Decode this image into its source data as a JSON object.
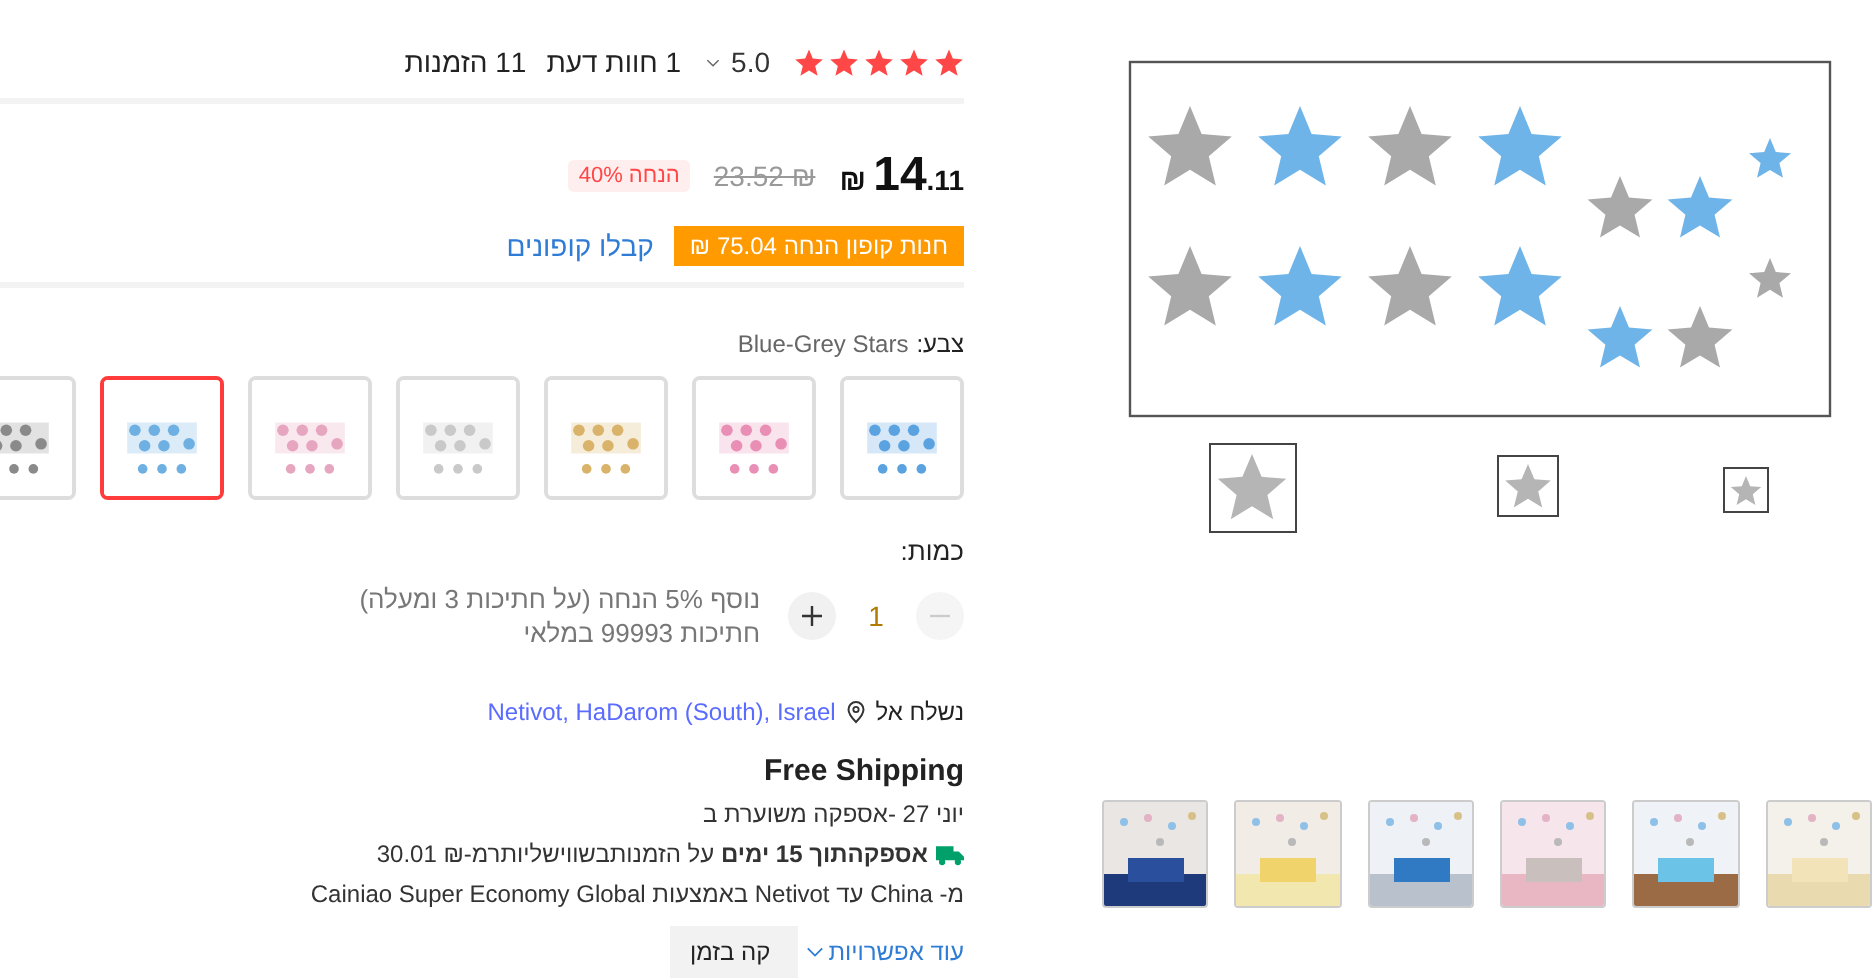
{
  "rating": {
    "stars": 5,
    "score": "5.0",
    "reviews": "1 חוות דעת",
    "orders": "11 הזמנות"
  },
  "price": {
    "currency": "₪",
    "whole": "14",
    "fraction": ".11",
    "original": "23.52 ₪",
    "discount": "הנחה 40%"
  },
  "coupon": {
    "badge": "חנות קופון הנחה 75.04 ₪",
    "link": "קבלו קופונים"
  },
  "color": {
    "label": "צבע:",
    "value": "Blue-Grey Stars"
  },
  "swatches": [
    {
      "kind": "picture",
      "color": "#5aa3e0",
      "selected": false
    },
    {
      "kind": "picture",
      "color": "#e98fb5",
      "selected": false
    },
    {
      "kind": "picture",
      "color": "#d9b36a",
      "selected": false
    },
    {
      "kind": "picture",
      "color": "#c9c9c9",
      "selected": false
    },
    {
      "kind": "picture",
      "color": "#e6a6bf",
      "selected": false
    },
    {
      "kind": "picture",
      "color": "#6fb0e3",
      "selected": true
    },
    {
      "kind": "picture",
      "color": "#8a8a8a",
      "selected": false
    }
  ],
  "quantity": {
    "label": "כמות:",
    "value": "1",
    "minus_disabled": true,
    "note": "נוסף 5% הנחה (על חתיכות 3 ומעלה)",
    "stock": "חתיכות 99993 במלאי"
  },
  "shipping": {
    "ship_to_label": "נשלח אל",
    "location": "Netivot, HaDarom (South), Israel",
    "title": "Free Shipping",
    "estimate": "יוני 27 -אספקה משוערת ב",
    "fast": "**אספקהתוך 15 ימים** על הזמנותבשווישליותרמ-₪ 30.01",
    "route": "מ- China עד Netivot באמצעות Cainiao Super Economy Global",
    "covered": "קה בזמן",
    "more": "עוד אפשרויות"
  },
  "gallery": [
    {
      "kind": "picture"
    },
    {
      "kind": "picture"
    },
    {
      "kind": "picture"
    },
    {
      "kind": "picture"
    },
    {
      "kind": "picture"
    },
    {
      "kind": "picture"
    }
  ]
}
